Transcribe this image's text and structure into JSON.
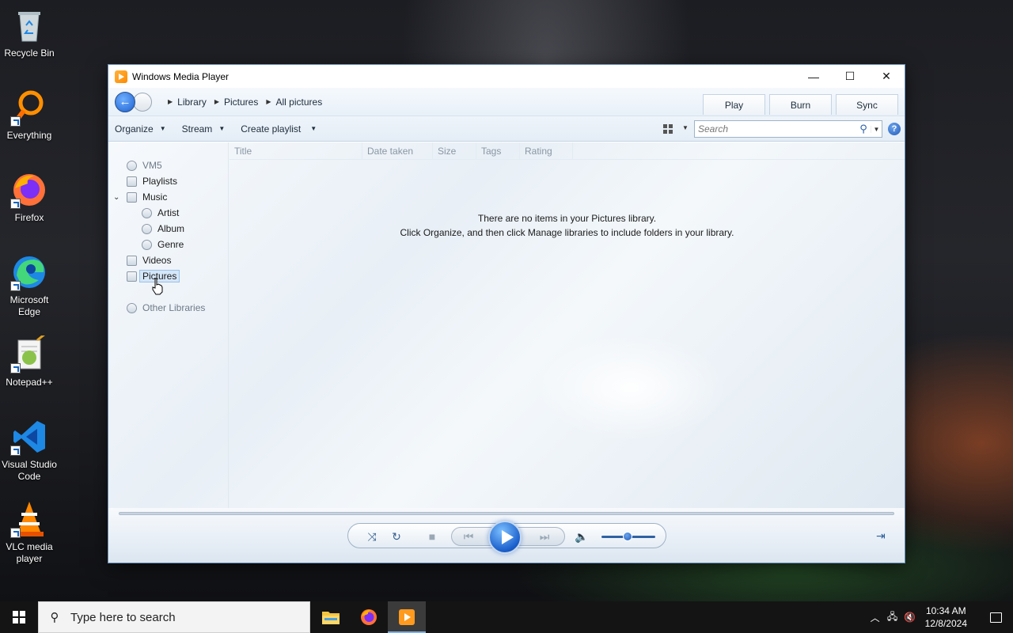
{
  "desktop": {
    "icons": [
      {
        "label": "Recycle Bin",
        "icon": "recycle-bin-icon"
      },
      {
        "label": "Everything",
        "icon": "everything-search-icon"
      },
      {
        "label": "Firefox",
        "icon": "firefox-icon"
      },
      {
        "label": "Microsoft Edge",
        "icon": "edge-icon"
      },
      {
        "label": "Notepad++",
        "icon": "notepad-plus-plus-icon"
      },
      {
        "label": "Visual Studio Code",
        "icon": "vscode-icon"
      },
      {
        "label": "VLC media player",
        "icon": "vlc-icon"
      }
    ]
  },
  "window": {
    "title": "Windows Media Player",
    "controls": {
      "minimize": "—",
      "maximize": "☐",
      "close": "✕"
    }
  },
  "navbar": {
    "breadcrumb": [
      "Library",
      "Pictures",
      "All pictures"
    ],
    "tabs": [
      "Play",
      "Burn",
      "Sync"
    ]
  },
  "toolbar": {
    "organize": "Organize",
    "stream": "Stream",
    "create_playlist": "Create playlist",
    "search_placeholder": "Search",
    "help": "?"
  },
  "sidebar": {
    "root": "VM5",
    "playlists": "Playlists",
    "music": "Music",
    "artist": "Artist",
    "album": "Album",
    "genre": "Genre",
    "videos": "Videos",
    "pictures": "Pictures",
    "other_libraries": "Other Libraries"
  },
  "columns": [
    "Title",
    "Date taken",
    "Size",
    "Tags",
    "Rating"
  ],
  "empty_message": {
    "line1": "There are no items in your Pictures library.",
    "line2": "Click Organize, and then click Manage libraries to include folders in your library."
  },
  "taskbar": {
    "search_placeholder": "Type here to search",
    "time": "10:34 AM",
    "date": "12/8/2024"
  },
  "colors": {
    "accent": "#1d5fcf",
    "taskbar": "#141414"
  }
}
